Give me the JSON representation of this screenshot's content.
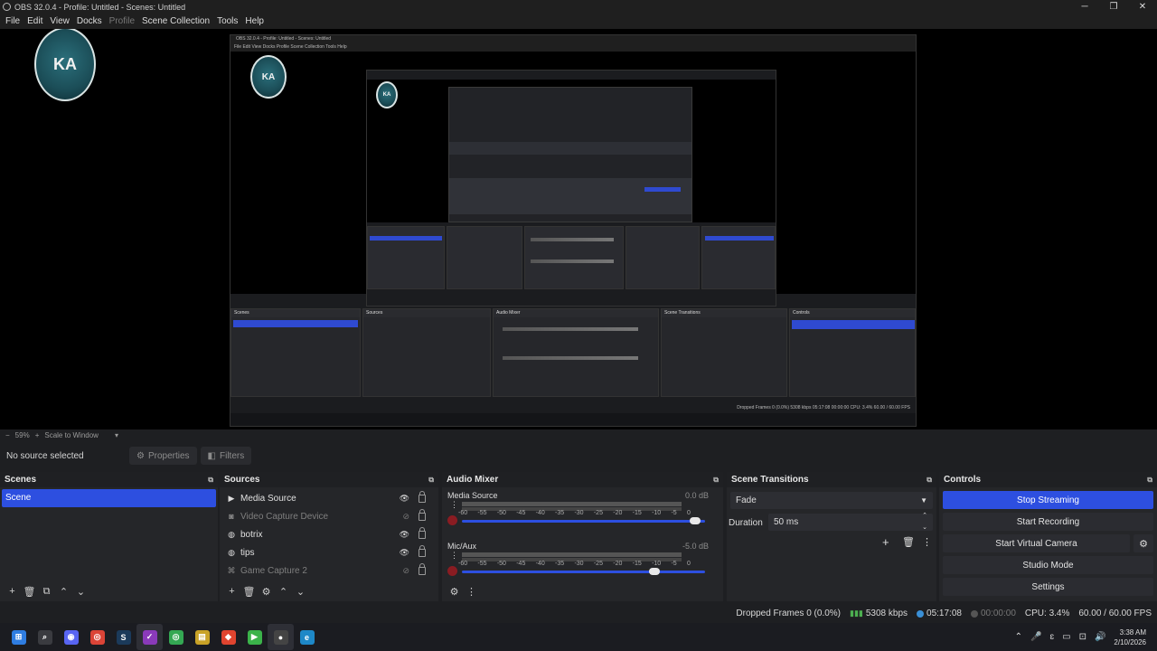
{
  "window": {
    "title": "OBS 32.0.4 - Profile: Untitled - Scenes: Untitled",
    "controls": [
      "─",
      "❐",
      "✕"
    ]
  },
  "menu": {
    "items": [
      "File",
      "Edit",
      "View",
      "Docks",
      "Profile",
      "Scene Collection",
      "Tools",
      "Help"
    ]
  },
  "preview": {
    "nested_title": "OBS 32.0.4 - Profile: Untitled - Scenes: Untitled",
    "nested_menu": "File   Edit   View   Docks   Profile   Scene Collection   Tools   Help",
    "nested_status": "Dropped Frames 0 (0.0%)   5308 kbps   05:17:08   00:00:00   CPU: 3.4%   60.00 / 60.00 FPS",
    "nested_docks": [
      "Scenes",
      "Sources",
      "Audio Mixer",
      "Scene Transitions",
      "Controls"
    ]
  },
  "zoombar": {
    "minus": "−",
    "zoom": "59%",
    "plus": "+",
    "scale_mode": "Scale to Window",
    "dropdown": "▾"
  },
  "source_bar": {
    "no_source": "No source selected",
    "properties": "Properties",
    "filters": "Filters"
  },
  "scenes": {
    "title": "Scenes",
    "items": [
      "Scene"
    ],
    "footer": [
      "+",
      "🗑",
      "⧉",
      "⌃",
      "⌄"
    ]
  },
  "sources": {
    "title": "Sources",
    "items": [
      {
        "name": "Media Source",
        "icon": "play-icon",
        "visible": true
      },
      {
        "name": "Video Capture Device",
        "icon": "camera-icon",
        "visible": false
      },
      {
        "name": "botrix",
        "icon": "globe-icon",
        "visible": true
      },
      {
        "name": "tips",
        "icon": "globe-icon",
        "visible": true
      },
      {
        "name": "Game Capture 2",
        "icon": "gamepad-icon",
        "visible": false
      }
    ],
    "footer": [
      "+",
      "🗑",
      "⚙",
      "⌃",
      "⌄"
    ]
  },
  "mixer": {
    "title": "Audio Mixer",
    "channels": [
      {
        "name": "Media Source",
        "db": "0.0 dB",
        "level": 0.96
      },
      {
        "name": "Mic/Aux",
        "db": "-5.0 dB",
        "level": 0.79
      }
    ],
    "scale": [
      "-60",
      "-55",
      "-50",
      "-45",
      "-40",
      "-35",
      "-30",
      "-25",
      "-20",
      "-15",
      "-10",
      "-5",
      "0"
    ],
    "footer": [
      "⚙",
      "⋮"
    ]
  },
  "transitions": {
    "title": "Scene Transitions",
    "selected": "Fade",
    "duration_label": "Duration",
    "duration_value": "50 ms",
    "buttons": [
      "+",
      "🗑",
      "⋮"
    ]
  },
  "controls": {
    "title": "Controls",
    "buttons": [
      "Stop Streaming",
      "Start Recording",
      "Start Virtual Camera",
      "Studio Mode",
      "Settings"
    ]
  },
  "status": {
    "dropped": "Dropped Frames 0 (0.0%)",
    "bitrate": "5308 kbps",
    "live_time": "05:17:08",
    "rec_time": "00:00:00",
    "cpu": "CPU: 3.4%",
    "fps": "60.00 / 60.00 FPS"
  },
  "taskbar": {
    "apps": [
      {
        "name": "windows-start-icon",
        "glyph": "⊞",
        "color": "#2f7de1"
      },
      {
        "name": "search-icon",
        "glyph": "⌕",
        "color": "#3a3b40"
      },
      {
        "name": "discord-icon",
        "glyph": "◉",
        "color": "#5865f2"
      },
      {
        "name": "chrome-icon",
        "glyph": "◎",
        "color": "#db4437"
      },
      {
        "name": "steam-app-icon",
        "glyph": "S",
        "color": "#1b3a5a"
      },
      {
        "name": "twitch-icon",
        "glyph": "✓",
        "color": "#8a3ab9"
      },
      {
        "name": "chrome-profile-icon",
        "glyph": "◎",
        "color": "#34a853"
      },
      {
        "name": "files-icon",
        "glyph": "▤",
        "color": "#c9a227"
      },
      {
        "name": "brave-icon",
        "glyph": "◆",
        "color": "#e0442f"
      },
      {
        "name": "play-store-icon",
        "glyph": "▶",
        "color": "#3bb34a"
      },
      {
        "name": "obs-icon",
        "glyph": "●",
        "color": "#444"
      },
      {
        "name": "edge-icon",
        "glyph": "e",
        "color": "#1e88c7"
      }
    ],
    "tray": [
      "⌃",
      "🎤",
      "ɛ",
      "▭",
      "⊡",
      "🔊"
    ],
    "time": "3:38 AM",
    "date": "2/10/2026"
  }
}
